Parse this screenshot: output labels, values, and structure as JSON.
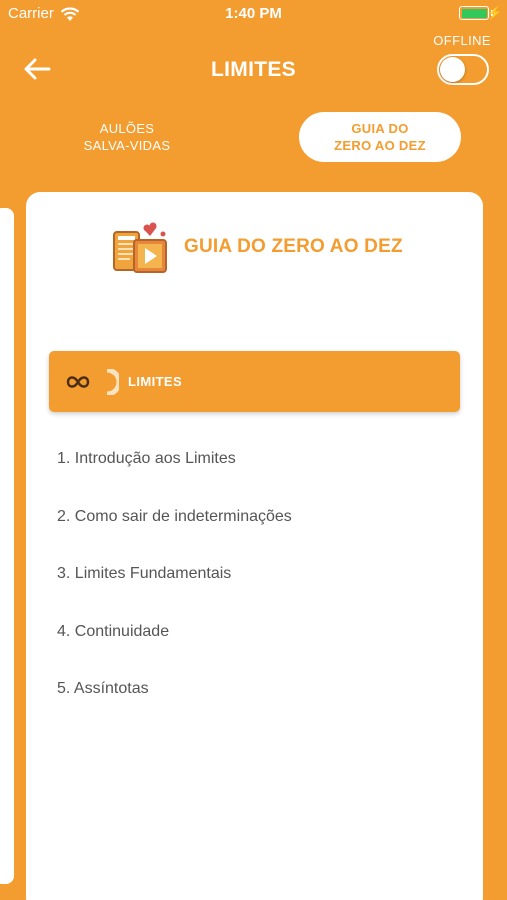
{
  "status_bar": {
    "carrier": "Carrier",
    "time": "1:40 PM"
  },
  "header": {
    "title": "LIMITES",
    "offline_label": "OFFLINE",
    "offline_enabled": false
  },
  "tabs": [
    {
      "label_line1": "AULÕES",
      "label_line2": "SALVA-VIDAS",
      "selected": false
    },
    {
      "label_line1": "GUIA DO",
      "label_line2": "ZERO AO DEZ",
      "selected": true
    }
  ],
  "guide": {
    "title": "GUIA DO ZERO AO DEZ"
  },
  "section": {
    "title": "LIMITES",
    "icon": "infinity-icon"
  },
  "topics": [
    "1. Introdução aos Limites",
    "2. Como sair de indeterminações",
    "3. Limites Fundamentais",
    "4. Continuidade",
    "5. Assíntotas"
  ],
  "colors": {
    "accent": "#f39c2f",
    "card": "#ffffff",
    "text": "#555555",
    "battery": "#34c759"
  }
}
